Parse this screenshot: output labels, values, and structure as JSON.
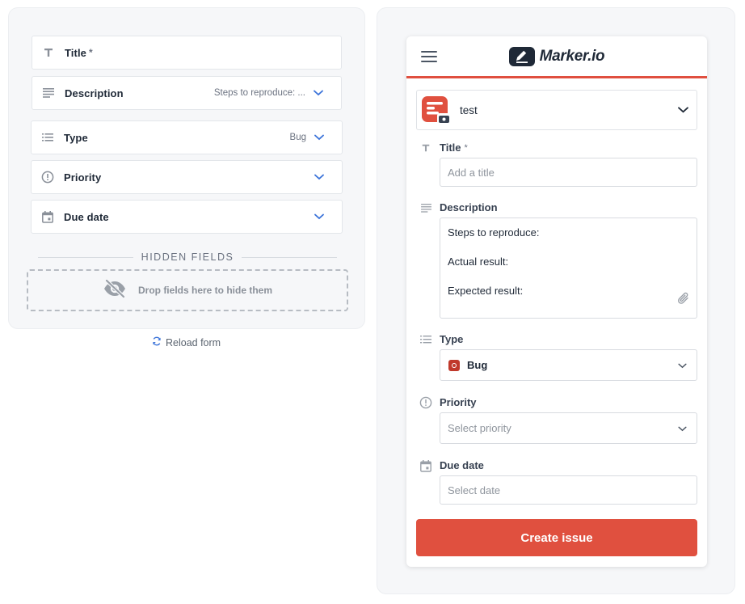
{
  "builder": {
    "fields": [
      {
        "name": "Title",
        "required_mark": "*",
        "value": "",
        "icon": "text-icon"
      },
      {
        "name": "Description",
        "value": "Steps to reproduce: ...",
        "icon": "lines-icon"
      },
      {
        "name": "Type",
        "value": "Bug",
        "icon": "list-icon"
      },
      {
        "name": "Priority",
        "value": "",
        "icon": "priority-icon"
      },
      {
        "name": "Due date",
        "value": "",
        "icon": "calendar-icon"
      }
    ],
    "hidden_header": "HIDDEN FIELDS",
    "dropzone_text": "Drop fields here to hide them",
    "reload_label": "Reload form"
  },
  "widget": {
    "brand": "Marker.io",
    "project": {
      "name": "test"
    },
    "title": {
      "label": "Title",
      "required_mark": "*",
      "placeholder": "Add a title"
    },
    "description": {
      "label": "Description",
      "lines": [
        "Steps to reproduce:",
        "Actual result:",
        "Expected result:"
      ]
    },
    "type": {
      "label": "Type",
      "value": "Bug"
    },
    "priority": {
      "label": "Priority",
      "placeholder": "Select priority"
    },
    "due_date": {
      "label": "Due date",
      "placeholder": "Select date"
    },
    "submit_label": "Create issue"
  },
  "colors": {
    "accent": "#e0503f",
    "link_blue": "#3b73d9",
    "panel_bg": "#f6f7f9"
  }
}
